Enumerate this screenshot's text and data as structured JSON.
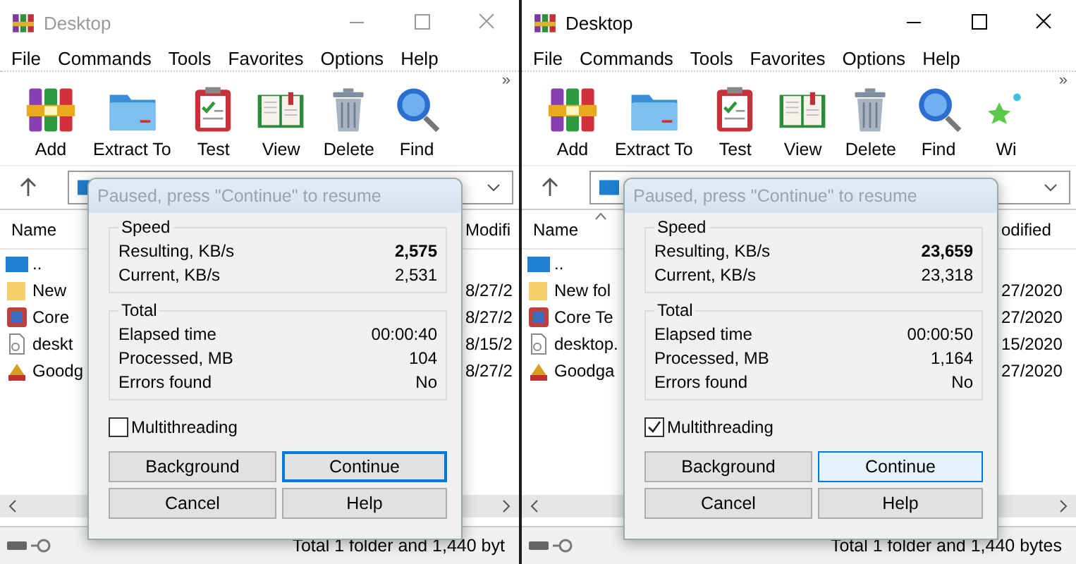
{
  "windows": [
    {
      "active": false,
      "title": "Desktop",
      "menu": [
        "File",
        "Commands",
        "Tools",
        "Favorites",
        "Options",
        "Help"
      ],
      "toolbar": [
        {
          "label": "Add",
          "kind": "archive"
        },
        {
          "label": "Extract To",
          "kind": "folder"
        },
        {
          "label": "Test",
          "kind": "clipboard"
        },
        {
          "label": "View",
          "kind": "book"
        },
        {
          "label": "Delete",
          "kind": "trash"
        },
        {
          "label": "Find",
          "kind": "magnifier"
        }
      ],
      "more": "»",
      "header": {
        "name": "Name",
        "modified": "Modifi"
      },
      "files": [
        {
          "name": "..",
          "kind": "up"
        },
        {
          "name": "New",
          "modified": "8/27/2",
          "kind": "folder"
        },
        {
          "name": "Core",
          "modified": "8/27/2",
          "kind": "app"
        },
        {
          "name": "deskt",
          "modified": "8/15/2",
          "kind": "settings"
        },
        {
          "name": "Goodg",
          "modified": "8/27/2",
          "kind": "game"
        }
      ],
      "status": "Total 1 folder and 1,440 byt",
      "dialog": {
        "title": "Paused, press \"Continue\" to resume",
        "groups": [
          {
            "heading": "Speed",
            "rows": [
              {
                "label": "Resulting, KB/s",
                "value": "2,575",
                "bold": true
              },
              {
                "label": "Current, KB/s",
                "value": "2,531",
                "bold": false
              }
            ]
          },
          {
            "heading": "Total",
            "rows": [
              {
                "label": "Elapsed time",
                "value": "00:00:40",
                "bold": false
              },
              {
                "label": "Processed, MB",
                "value": "104",
                "bold": false
              },
              {
                "label": "Errors found",
                "value": "No",
                "bold": false
              }
            ]
          }
        ],
        "multithreading": {
          "label": "Multithreading",
          "checked": false
        },
        "buttons": [
          {
            "label": "Background",
            "focused": false,
            "hovered": false
          },
          {
            "label": "Continue",
            "focused": true,
            "hovered": false
          },
          {
            "label": "Cancel",
            "focused": false,
            "hovered": false
          },
          {
            "label": "Help",
            "focused": false,
            "hovered": false
          }
        ]
      }
    },
    {
      "active": true,
      "title": "Desktop",
      "menu": [
        "File",
        "Commands",
        "Tools",
        "Favorites",
        "Options",
        "Help"
      ],
      "toolbar": [
        {
          "label": "Add",
          "kind": "archive"
        },
        {
          "label": "Extract To",
          "kind": "folder"
        },
        {
          "label": "Test",
          "kind": "clipboard"
        },
        {
          "label": "View",
          "kind": "book"
        },
        {
          "label": "Delete",
          "kind": "trash"
        },
        {
          "label": "Find",
          "kind": "magnifier"
        },
        {
          "label": "Wi",
          "kind": "wizard"
        }
      ],
      "more": "»",
      "header": {
        "name": "Name",
        "modified": "odified",
        "sort_arrow": true
      },
      "files": [
        {
          "name": "..",
          "kind": "up"
        },
        {
          "name": "New fol",
          "modified": "27/2020",
          "kind": "folder"
        },
        {
          "name": "Core Te",
          "modified": "27/2020",
          "kind": "app"
        },
        {
          "name": "desktop.",
          "modified": "15/2020",
          "kind": "settings"
        },
        {
          "name": "Goodga",
          "modified": "27/2020",
          "kind": "game"
        }
      ],
      "status": "Total 1 folder and 1,440 bytes",
      "dialog": {
        "title": "Paused, press \"Continue\" to resume",
        "groups": [
          {
            "heading": "Speed",
            "rows": [
              {
                "label": "Resulting, KB/s",
                "value": "23,659",
                "bold": true
              },
              {
                "label": "Current, KB/s",
                "value": "23,318",
                "bold": false
              }
            ]
          },
          {
            "heading": "Total",
            "rows": [
              {
                "label": "Elapsed time",
                "value": "00:00:50",
                "bold": false
              },
              {
                "label": "Processed, MB",
                "value": "1,164",
                "bold": false
              },
              {
                "label": "Errors found",
                "value": "No",
                "bold": false
              }
            ]
          }
        ],
        "multithreading": {
          "label": "Multithreading",
          "checked": true
        },
        "buttons": [
          {
            "label": "Background",
            "focused": false,
            "hovered": false
          },
          {
            "label": "Continue",
            "focused": false,
            "hovered": true
          },
          {
            "label": "Cancel",
            "focused": false,
            "hovered": false
          },
          {
            "label": "Help",
            "focused": false,
            "hovered": false
          }
        ]
      }
    }
  ]
}
